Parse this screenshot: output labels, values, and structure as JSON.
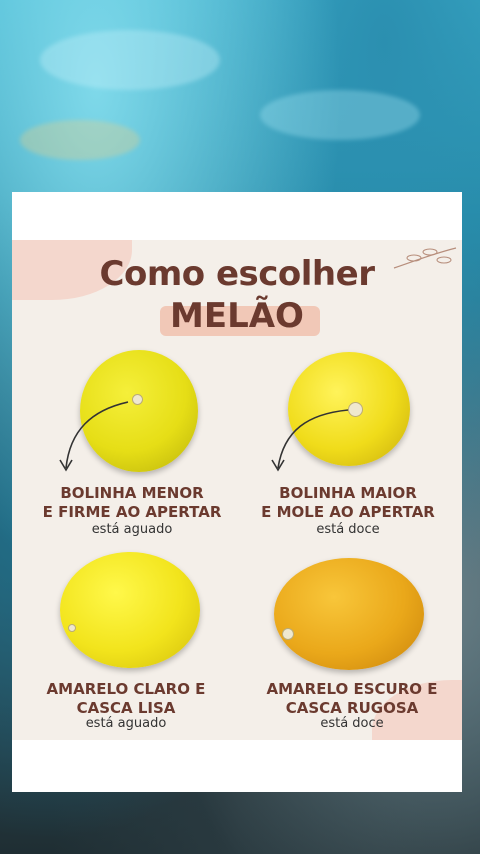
{
  "infographic": {
    "title_line1": "Como escolher",
    "title_line2": "MELÃO",
    "items": [
      {
        "line1": "BOLINHA MENOR",
        "line2": "E FIRME AO APERTAR",
        "verdict": "está aguado"
      },
      {
        "line1": "BOLINHA MAIOR",
        "line2": "E MOLE AO APERTAR",
        "verdict": "está doce"
      },
      {
        "line1": "AMARELO CLARO E",
        "line2": "CASCA LISA",
        "verdict": "está aguado"
      },
      {
        "line1": "AMARELO ESCURO E",
        "line2": "CASCA RUGOSA",
        "verdict": "está doce"
      }
    ]
  },
  "colors": {
    "title": "#6b3a2f",
    "accent_blob": "#f4d7cd",
    "background_water": "#1a7995"
  }
}
